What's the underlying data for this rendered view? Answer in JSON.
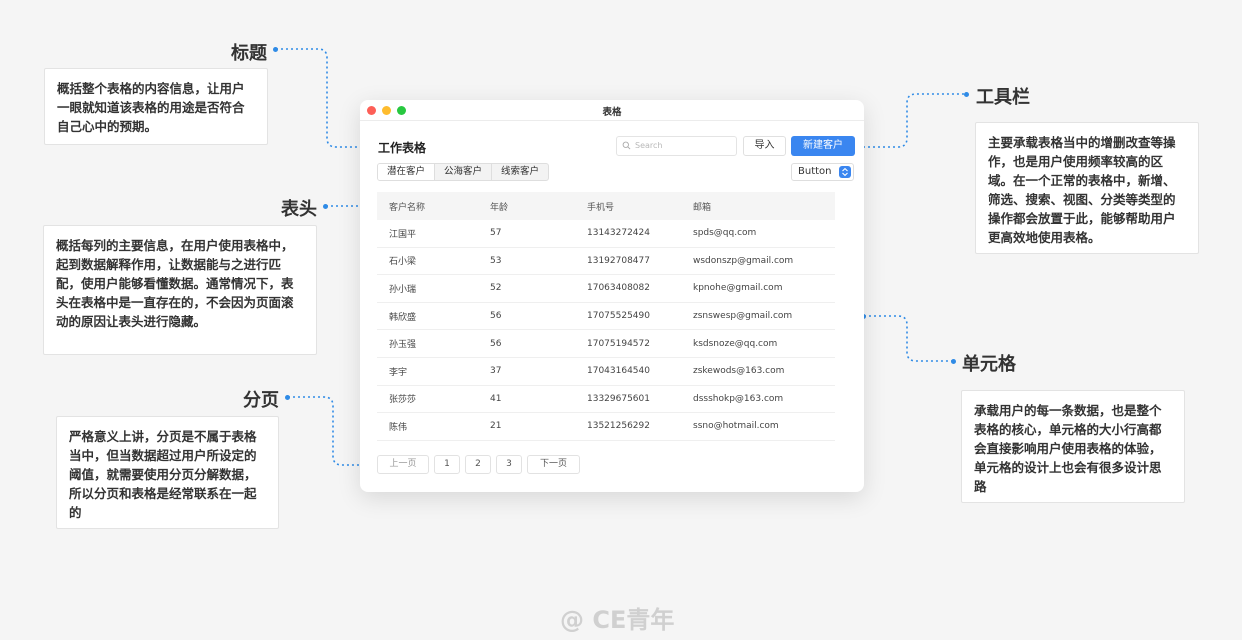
{
  "annotations": {
    "title": {
      "label": "标题",
      "text": "概括整个表格的内容信息，让用户一眼就知道该表格的用途是否符合自己心中的预期。"
    },
    "toolbar": {
      "label": "工具栏",
      "text": "主要承载表格当中的增删改查等操作，也是用户使用频率较高的区域。在一个正常的表格中，新增、筛选、搜索、视图、分类等类型的操作都会放置于此，能够帮助用户更高效地使用表格。"
    },
    "header": {
      "label": "表头",
      "text": "概括每列的主要信息，在用户使用表格中，起到数据解释作用，让数据能与之进行匹配，使用户能够看懂数据。通常情况下，表头在表格中是一直存在的，不会因为页面滚动的原因让表头进行隐藏。"
    },
    "cell": {
      "label": "单元格",
      "text": "承载用户的每一条数据，也是整个表格的核心，单元格的大小行高都会直接影响用户使用表格的体验，单元格的设计上也会有很多设计思路"
    },
    "pagination": {
      "label": "分页",
      "text": "严格意义上讲，分页是不属于表格当中，但当数据超过用户所设定的阈值，就需要使用分页分解数据，所以分页和表格是经常联系在一起的"
    }
  },
  "window": {
    "title": "表格",
    "page_title": "工作表格",
    "search_placeholder": "Search",
    "import_label": "导入",
    "new_label": "新建客户",
    "tabs": [
      "潜在客户",
      "公海客户",
      "线索客户"
    ],
    "select_label": "Button"
  },
  "table": {
    "columns": [
      "客户名称",
      "年龄",
      "手机号",
      "邮箱"
    ],
    "rows": [
      [
        "江国平",
        "57",
        "13143272424",
        "spds@qq.com"
      ],
      [
        "石小梁",
        "53",
        "13192708477",
        "wsdonszp@gmail.com"
      ],
      [
        "孙小瑞",
        "52",
        "17063408082",
        "kpnohe@gmail.com"
      ],
      [
        "韩欣盛",
        "56",
        "17075525490",
        "zsnswesp@gmail.com"
      ],
      [
        "孙玉强",
        "56",
        "17075194572",
        "ksdsnoze@qq.com"
      ],
      [
        "李宇",
        "37",
        "17043164540",
        "zskewods@163.com"
      ],
      [
        "张莎莎",
        "41",
        "13329675601",
        "dssshokp@163.com"
      ],
      [
        "陈伟",
        "21",
        "13521256292",
        "ssno@hotmail.com"
      ]
    ]
  },
  "pagination": {
    "prev": "上一页",
    "pages": [
      "1",
      "2",
      "3"
    ],
    "next": "下一页"
  },
  "watermark": "@ CE青年",
  "accent_color": "#3a86f0"
}
